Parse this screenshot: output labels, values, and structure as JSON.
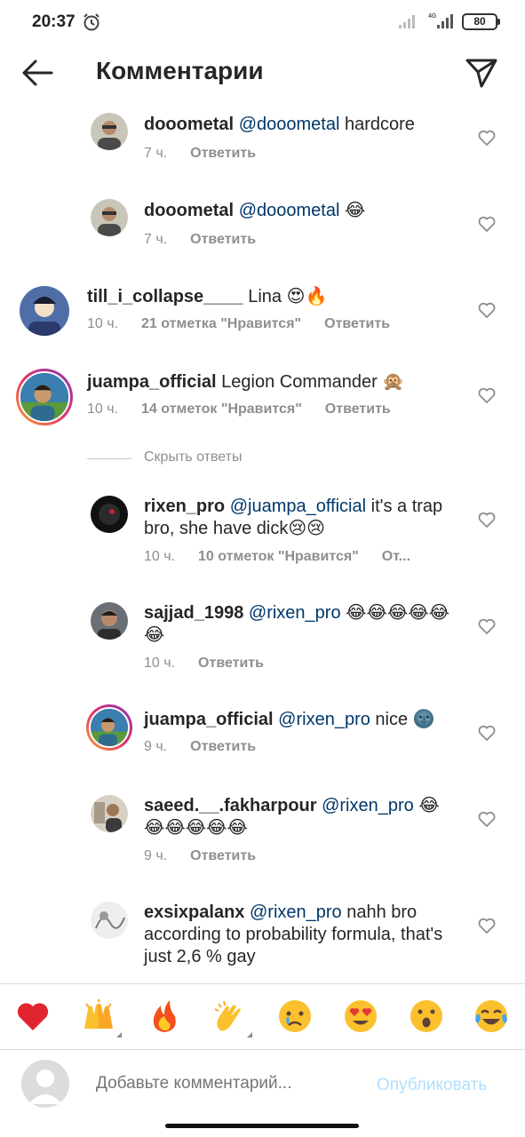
{
  "status": {
    "time": "20:37",
    "network": "4G",
    "battery": "80"
  },
  "header": {
    "title": "Комментарии"
  },
  "comments": [
    {
      "user": "dooometal",
      "mention": "@dooometal",
      "text": " hardcore",
      "time": "7 ч.",
      "reply": "Ответить"
    },
    {
      "user": "dooometal",
      "mention": "@dooometal",
      "text": " 😂",
      "time": "7 ч.",
      "reply": "Ответить"
    },
    {
      "user": "till_i_collapse____",
      "mention": "",
      "text": " Lina 😍🔥",
      "time": "10 ч.",
      "likes": "21 отметка \"Нравится\"",
      "reply": "Ответить"
    },
    {
      "user": "juampa_official",
      "mention": "",
      "text": " Legion Commander 🙊",
      "time": "10 ч.",
      "likes": "14 отметок \"Нравится\"",
      "reply": "Ответить"
    },
    {
      "user": "rixen_pro",
      "mention": "@juampa_official",
      "text": " it's a trap bro, she have dick😢😢",
      "time": "10 ч.",
      "likes": "10 отметок \"Нравится\"",
      "reply": "От..."
    },
    {
      "user": "sajjad_1998",
      "mention": "@rixen_pro",
      "text": " 😂😂😂😂😂😂",
      "time": "10 ч.",
      "reply": "Ответить"
    },
    {
      "user": "juampa_official",
      "mention": "@rixen_pro",
      "text": " nice 🌚",
      "time": "9 ч.",
      "reply": "Ответить"
    },
    {
      "user": "saeed.__.fakharpour",
      "mention": "@rixen_pro",
      "text": " 😂😂😂😂😂😂",
      "time": "9 ч.",
      "reply": "Ответить"
    },
    {
      "user": "exsixpalanx",
      "mention": "@rixen_pro",
      "text": " nahh bro according to probability formula, that's just 2,6 % gay",
      "time": "",
      "reply": ""
    }
  ],
  "hide_replies": "Скрыть ответы",
  "emoji_bar": [
    "❤️",
    "🙌",
    "🔥",
    "👏",
    "😢",
    "😍",
    "😮",
    "😂"
  ],
  "composer": {
    "placeholder": "Добавьте комментарий...",
    "post_label": "Опубликовать"
  },
  "colors": {
    "mention": "#00376b",
    "meta": "#8e8e8e",
    "post_disabled": "#b2dffc"
  }
}
